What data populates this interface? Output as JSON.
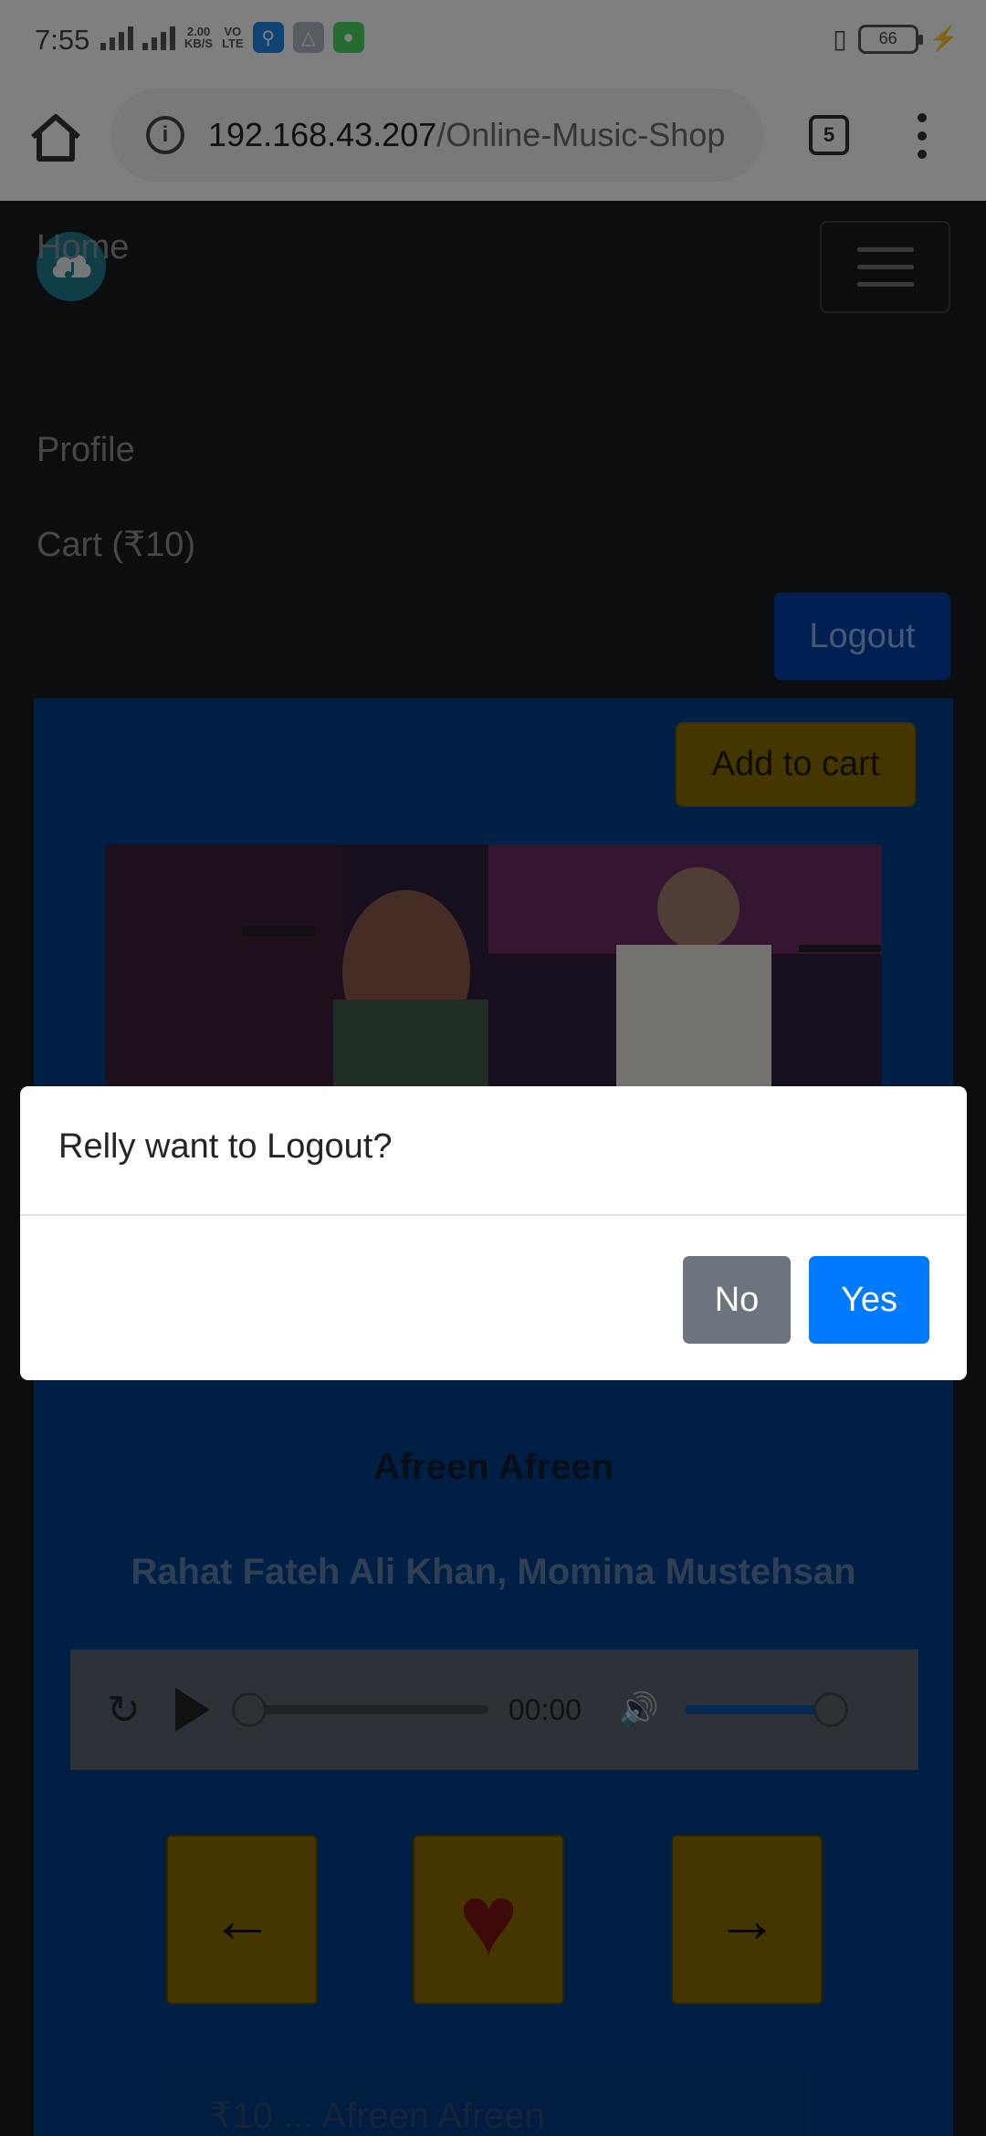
{
  "status_bar": {
    "time": "7:55",
    "network_speed": "2.00\nKB/S",
    "network_type": "4G",
    "volte": "VO\nLTE",
    "battery_level": "66"
  },
  "browser": {
    "url_host": "192.168.43.207",
    "url_path": "/Online-Music-Shop",
    "tab_count": "5"
  },
  "site": {
    "nav": {
      "home": "Home",
      "profile": "Profile",
      "cart": "Cart (₹10)",
      "logout": "Logout"
    },
    "card": {
      "add_to_cart": "Add to cart",
      "song_title": "Afreen Afreen",
      "artists": "Rahat Fateh Ali Khan, Momina Mustehsan",
      "player_time": "00:00",
      "prev_symbol": "←",
      "fav_symbol": "♥",
      "next_symbol": "→",
      "bottom_text": "₹10 ... Afreen Afreen"
    }
  },
  "dialog": {
    "message": "Relly want to Logout?",
    "no_label": "No",
    "yes_label": "Yes"
  },
  "colors": {
    "accent": "#007bff",
    "card_bg": "#003e8a",
    "button_gold": "#8a6d00"
  }
}
